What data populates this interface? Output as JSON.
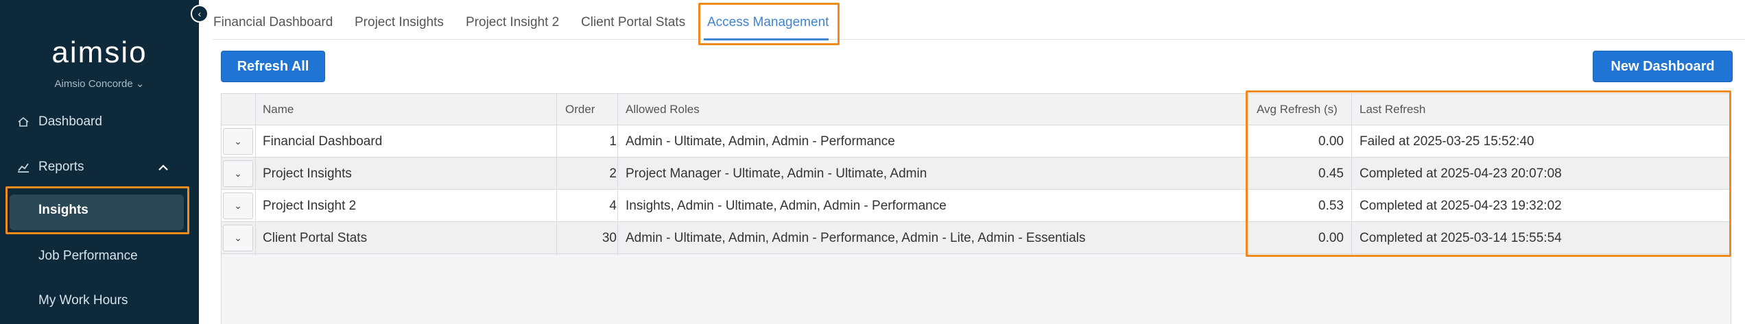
{
  "sidebar": {
    "logo": "aimsio",
    "org": "Aimsio Concorde ⌄",
    "items": [
      {
        "label": "Dashboard",
        "icon": "home-icon"
      },
      {
        "label": "Reports",
        "icon": "chart-icon"
      }
    ],
    "sub_items": [
      "Insights",
      "Job Performance",
      "My Work Hours"
    ],
    "collapse_glyph": "‹"
  },
  "tabs": [
    "Financial Dashboard",
    "Project Insights",
    "Project Insight 2",
    "Client Portal Stats",
    "Access Management"
  ],
  "active_tab": "Access Management",
  "toolbar": {
    "refresh_all_label": "Refresh All",
    "new_dashboard_label": "New Dashboard"
  },
  "table": {
    "columns": [
      "Name",
      "Order",
      "Allowed Roles",
      "Avg Refresh (s)",
      "Last Refresh"
    ],
    "rows": [
      {
        "name": "Financial Dashboard",
        "order": "1",
        "roles": "Admin - Ultimate, Admin, Admin - Performance",
        "avg": "0.00",
        "last": "Failed at 2025-03-25 15:52:40"
      },
      {
        "name": "Project Insights",
        "order": "2",
        "roles": "Project Manager - Ultimate, Admin - Ultimate, Admin",
        "avg": "0.45",
        "last": "Completed at 2025-04-23 20:07:08"
      },
      {
        "name": "Project Insight 2",
        "order": "4",
        "roles": "Insights, Admin - Ultimate, Admin, Admin - Performance",
        "avg": "0.53",
        "last": "Completed at 2025-04-23 19:32:02"
      },
      {
        "name": "Client Portal Stats",
        "order": "30",
        "roles": "Admin - Ultimate, Admin, Admin - Performance, Admin - Lite, Admin - Essentials",
        "avg": "0.00",
        "last": "Completed at 2025-03-14 15:55:54"
      }
    ],
    "expand_glyph": "⌄"
  },
  "colors": {
    "sidebar_bg": "#0e2a3a",
    "primary": "#1f74d4",
    "active_tab": "#3e84cf",
    "highlight": "#f08a1c"
  }
}
